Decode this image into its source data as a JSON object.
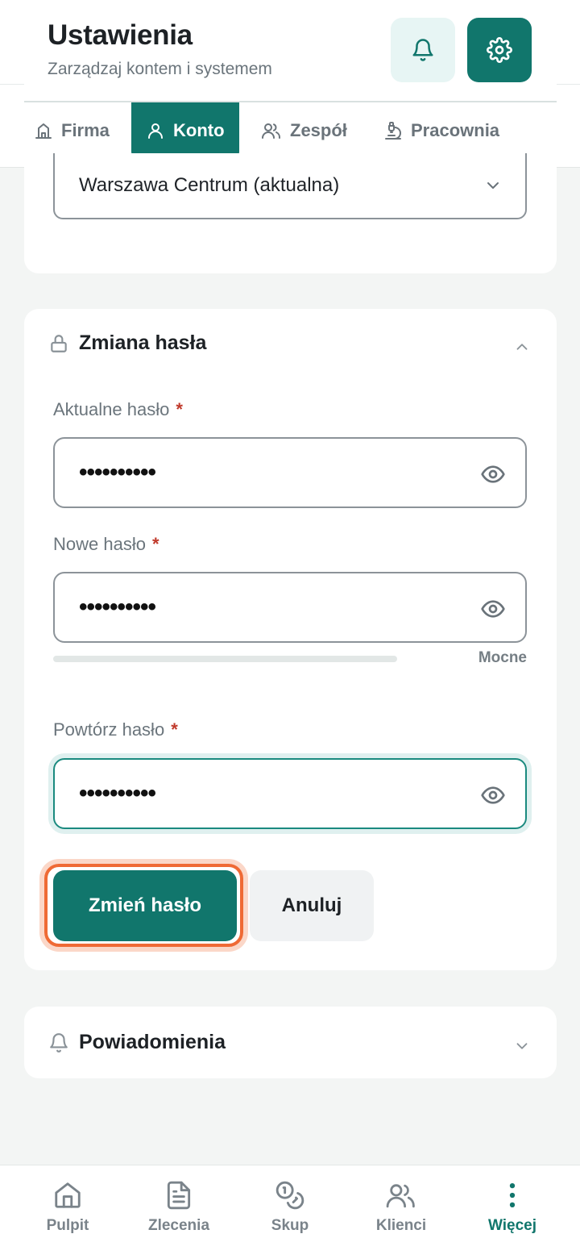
{
  "header": {
    "title": "Ustawienia",
    "subtitle": "Zarządzaj kontem i systemem",
    "bell_icon": "bell-icon",
    "settings_icon": "gear-icon"
  },
  "tabs": [
    {
      "label": "Firma",
      "icon": "building-icon"
    },
    {
      "label": "Konto",
      "icon": "user-icon",
      "active": true
    },
    {
      "label": "Zespół",
      "icon": "users-icon"
    },
    {
      "label": "Pracownia",
      "icon": "microscope-icon"
    }
  ],
  "location_select": {
    "value": "Warszawa Centrum (aktualna)"
  },
  "password_section": {
    "title": "Zmiana hasła",
    "icon": "lock-icon",
    "expanded": true,
    "current": {
      "label": "Aktualne hasło",
      "required_mark": "*",
      "value": "••••••••••"
    },
    "new": {
      "label": "Nowe hasło",
      "required_mark": "*",
      "value": "••••••••••"
    },
    "strength_label": "Mocne",
    "repeat": {
      "label": "Powtórz hasło",
      "required_mark": "*",
      "value": "••••••••••"
    },
    "submit_label": "Zmień hasło",
    "cancel_label": "Anuluj"
  },
  "notifications_section": {
    "title": "Powiadomienia",
    "icon": "bell-icon",
    "expanded": false
  },
  "bottom_nav": [
    {
      "label": "Pulpit",
      "icon": "home-icon"
    },
    {
      "label": "Zlecenia",
      "icon": "document-icon"
    },
    {
      "label": "Skup",
      "icon": "coins-icon"
    },
    {
      "label": "Klienci",
      "icon": "users-icon"
    },
    {
      "label": "Więcej",
      "icon": "more-vertical-icon",
      "active": true
    }
  ],
  "colors": {
    "accent": "#11766c",
    "accent_light": "#e7f5f4",
    "highlight_ring": "#ef6a35",
    "required": "#c0392b"
  }
}
